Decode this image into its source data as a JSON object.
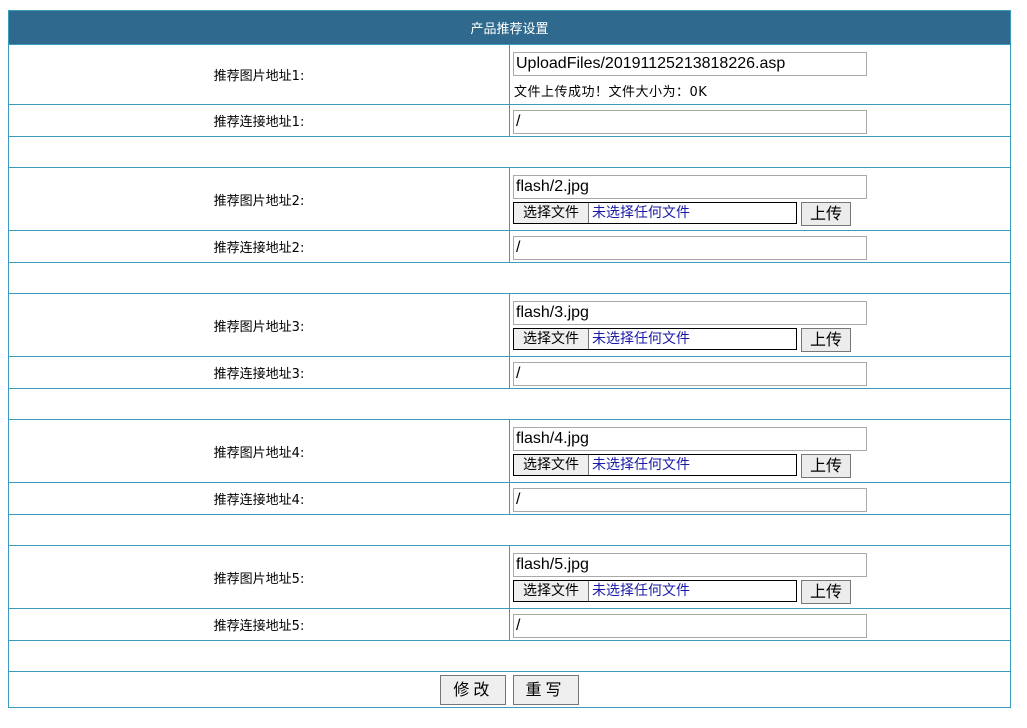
{
  "header": {
    "title": "产品推荐设置"
  },
  "items": [
    {
      "image_label": "推荐图片地址1:",
      "image_value": "UploadFiles/20191125213818226.asp",
      "upload_message": "文件上传成功！文件大小为：0K",
      "link_label": "推荐连接地址1:",
      "link_value": "/"
    },
    {
      "image_label": "推荐图片地址2:",
      "image_value": "flash/2.jpg",
      "link_label": "推荐连接地址2:",
      "link_value": "/"
    },
    {
      "image_label": "推荐图片地址3:",
      "image_value": "flash/3.jpg",
      "link_label": "推荐连接地址3:",
      "link_value": "/"
    },
    {
      "image_label": "推荐图片地址4:",
      "image_value": "flash/4.jpg",
      "link_label": "推荐连接地址4:",
      "link_value": "/"
    },
    {
      "image_label": "推荐图片地址5:",
      "image_value": "flash/5.jpg",
      "link_label": "推荐连接地址5:",
      "link_value": "/"
    }
  ],
  "file_picker": {
    "choose_label": "选择文件",
    "no_file_text": "未选择任何文件",
    "upload_label": "上传"
  },
  "actions": {
    "submit_label": "修改",
    "reset_label": "重写"
  },
  "colors": {
    "header_bg": "#2f6a8e",
    "border": "#3a9bbd",
    "file_text": "#1a1aa6"
  }
}
